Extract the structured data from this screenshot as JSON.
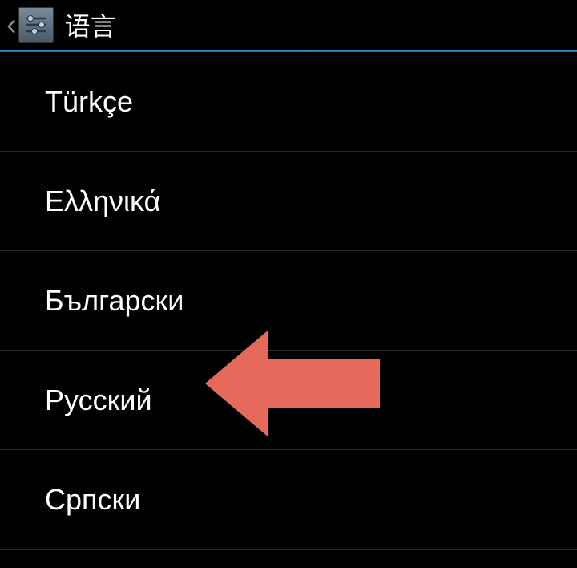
{
  "header": {
    "title": "语言"
  },
  "languages": [
    {
      "label": "Türkçe"
    },
    {
      "label": "Ελληνικά"
    },
    {
      "label": "Български"
    },
    {
      "label": "Русский"
    },
    {
      "label": "Српски"
    }
  ],
  "annotation": {
    "target_index": 3,
    "arrow_color": "#e66a5c"
  }
}
